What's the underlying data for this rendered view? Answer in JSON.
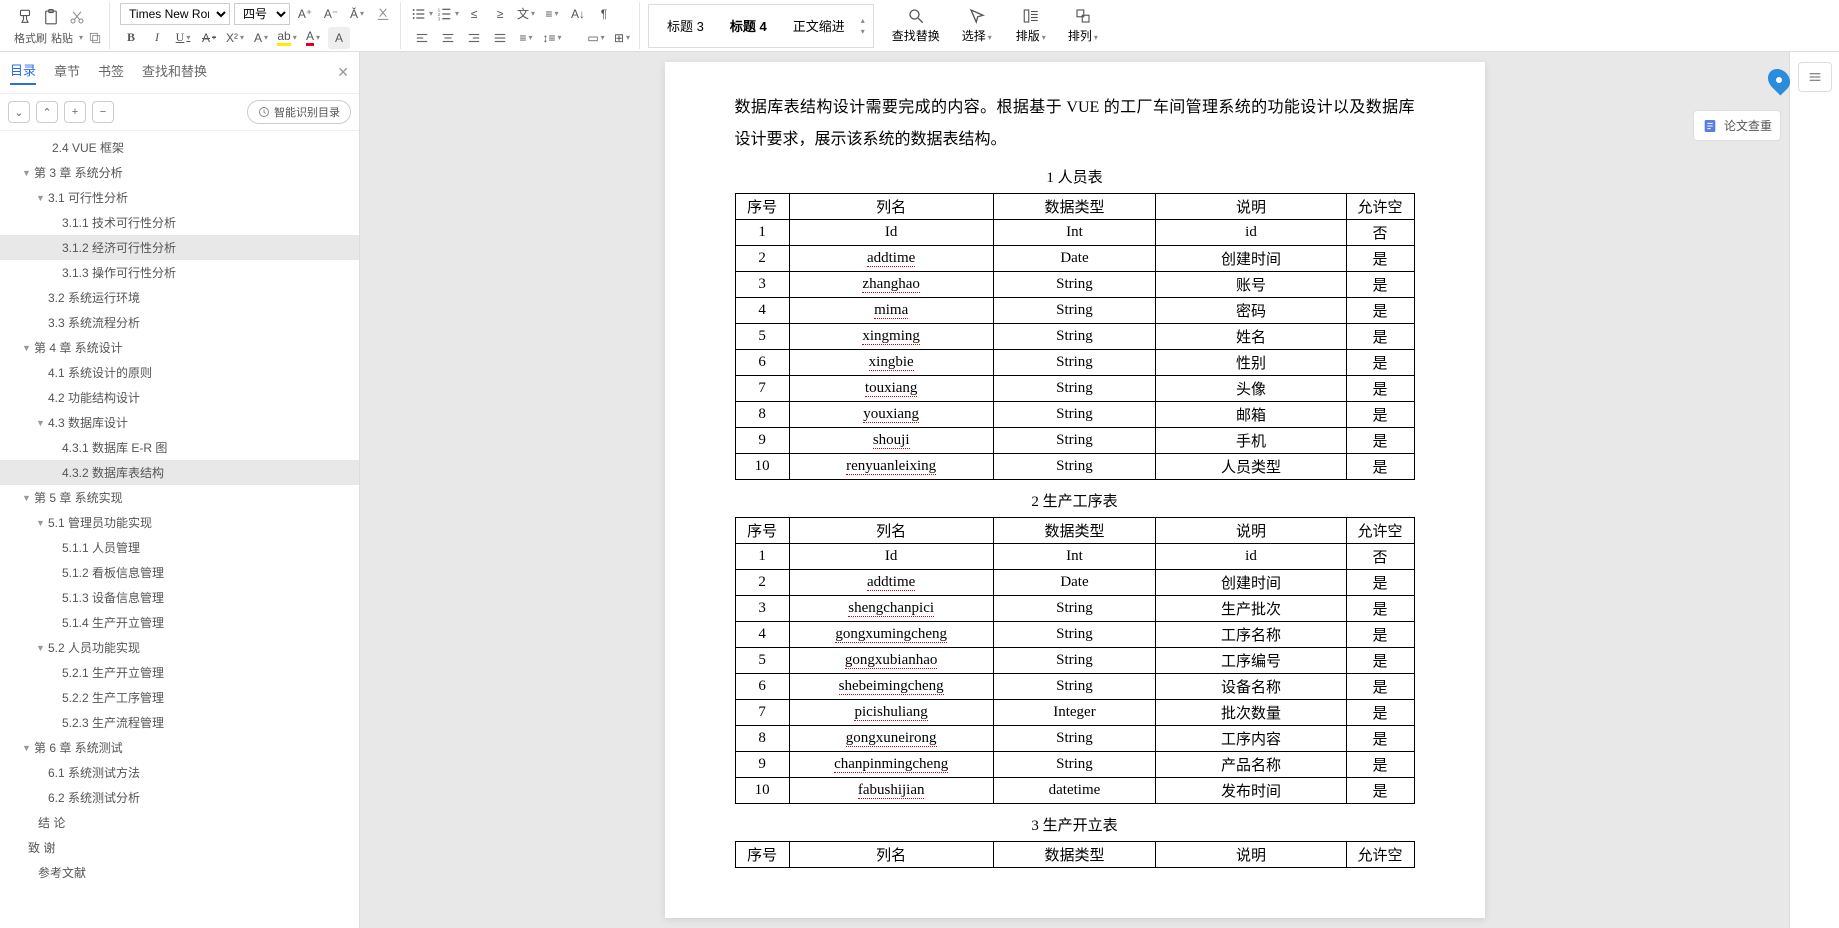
{
  "toolbar": {
    "formatPainter": "格式刷",
    "paste": "粘贴",
    "fontName": "Times New Roma",
    "fontSize": "四号",
    "findReplace": "查找替换",
    "select": "选择",
    "arrange": "排版",
    "arrange2": "排列",
    "styles": {
      "s1": "标题 3",
      "s2": "标题 4",
      "s3": "正文缩进"
    }
  },
  "nav": {
    "tabs": {
      "toc": "目录",
      "chapter": "章节",
      "bookmark": "书签",
      "findReplace": "查找和替换"
    },
    "smartToc": "智能识别目录",
    "items": [
      {
        "t": "2.4 VUE 框架",
        "indent": 40,
        "arrow": ""
      },
      {
        "t": "第 3 章  系统分析",
        "indent": 22,
        "arrow": "▼"
      },
      {
        "t": "3.1 可行性分析",
        "indent": 36,
        "arrow": "▼"
      },
      {
        "t": "3.1.1 技术可行性分析",
        "indent": 50,
        "arrow": ""
      },
      {
        "t": "3.1.2 经济可行性分析",
        "indent": 50,
        "arrow": "",
        "sel": true
      },
      {
        "t": "3.1.3 操作可行性分析",
        "indent": 50,
        "arrow": ""
      },
      {
        "t": "3.2 系统运行环境",
        "indent": 36,
        "arrow": ""
      },
      {
        "t": "3.3 系统流程分析",
        "indent": 36,
        "arrow": ""
      },
      {
        "t": "第 4 章  系统设计",
        "indent": 22,
        "arrow": "▼"
      },
      {
        "t": "4.1 系统设计的原则",
        "indent": 36,
        "arrow": ""
      },
      {
        "t": "4.2 功能结构设计",
        "indent": 36,
        "arrow": ""
      },
      {
        "t": "4.3 数据库设计",
        "indent": 36,
        "arrow": "▼"
      },
      {
        "t": "4.3.1 数据库 E-R 图",
        "indent": 50,
        "arrow": ""
      },
      {
        "t": "4.3.2 数据库表结构",
        "indent": 50,
        "arrow": "",
        "sel": true
      },
      {
        "t": "第 5 章  系统实现",
        "indent": 22,
        "arrow": "▼"
      },
      {
        "t": "5.1 管理员功能实现",
        "indent": 36,
        "arrow": "▼"
      },
      {
        "t": "5.1.1 人员管理",
        "indent": 50,
        "arrow": ""
      },
      {
        "t": "5.1.2 看板信息管理",
        "indent": 50,
        "arrow": ""
      },
      {
        "t": "5.1.3 设备信息管理",
        "indent": 50,
        "arrow": ""
      },
      {
        "t": "5.1.4 生产开立管理",
        "indent": 50,
        "arrow": ""
      },
      {
        "t": "5.2 人员功能实现",
        "indent": 36,
        "arrow": "▼"
      },
      {
        "t": "5.2.1 生产开立管理",
        "indent": 50,
        "arrow": ""
      },
      {
        "t": "5.2.2 生产工序管理",
        "indent": 50,
        "arrow": ""
      },
      {
        "t": "5.2.3 生产流程管理",
        "indent": 50,
        "arrow": ""
      },
      {
        "t": "第 6 章  系统测试",
        "indent": 22,
        "arrow": "▼"
      },
      {
        "t": "6.1 系统测试方法",
        "indent": 36,
        "arrow": ""
      },
      {
        "t": "6.2 系统测试分析",
        "indent": 36,
        "arrow": ""
      },
      {
        "t": "结  论",
        "indent": 26,
        "arrow": ""
      },
      {
        "t": "致  谢",
        "indent": 16,
        "arrow": ""
      },
      {
        "t": "参考文献",
        "indent": 26,
        "arrow": ""
      }
    ]
  },
  "doc": {
    "para": "数据库表结构设计需要完成的内容。根据基于 VUE 的工厂车间管理系统的功能设计以及数据库设计要求，展示该系统的数据表结构。",
    "headers": [
      "序号",
      "列名",
      "数据类型",
      "说明",
      "允许空"
    ],
    "table1": {
      "title": "1 人员表",
      "rows": [
        [
          "1",
          "Id",
          "Int",
          "id",
          "否"
        ],
        [
          "2",
          "addtime",
          "Date",
          "创建时间",
          "是"
        ],
        [
          "3",
          "zhanghao",
          "String",
          "账号",
          "是"
        ],
        [
          "4",
          "mima",
          "String",
          "密码",
          "是"
        ],
        [
          "5",
          "xingming",
          "String",
          "姓名",
          "是"
        ],
        [
          "6",
          "xingbie",
          "String",
          "性别",
          "是"
        ],
        [
          "7",
          "touxiang",
          "String",
          "头像",
          "是"
        ],
        [
          "8",
          "youxiang",
          "String",
          "邮箱",
          "是"
        ],
        [
          "9",
          "shouji",
          "String",
          "手机",
          "是"
        ],
        [
          "10",
          "renyuanleixing",
          "String",
          "人员类型",
          "是"
        ]
      ]
    },
    "table2": {
      "title": "2 生产工序表",
      "rows": [
        [
          "1",
          "Id",
          "Int",
          "id",
          "否"
        ],
        [
          "2",
          "addtime",
          "Date",
          "创建时间",
          "是"
        ],
        [
          "3",
          "shengchanpici",
          "String",
          "生产批次",
          "是"
        ],
        [
          "4",
          "gongxumingcheng",
          "String",
          "工序名称",
          "是"
        ],
        [
          "5",
          "gongxubianhao",
          "String",
          "工序编号",
          "是"
        ],
        [
          "6",
          "shebeimingcheng",
          "String",
          "设备名称",
          "是"
        ],
        [
          "7",
          "picishuliang",
          "Integer",
          "批次数量",
          "是"
        ],
        [
          "8",
          "gongxuneirong",
          "String",
          "工序内容",
          "是"
        ],
        [
          "9",
          "chanpinmingcheng",
          "String",
          "产品名称",
          "是"
        ],
        [
          "10",
          "fabushijian",
          "datetime",
          "发布时间",
          "是"
        ]
      ]
    },
    "table3": {
      "title": "3 生产开立表"
    }
  },
  "rightPanel": {
    "check": "论文查重"
  }
}
